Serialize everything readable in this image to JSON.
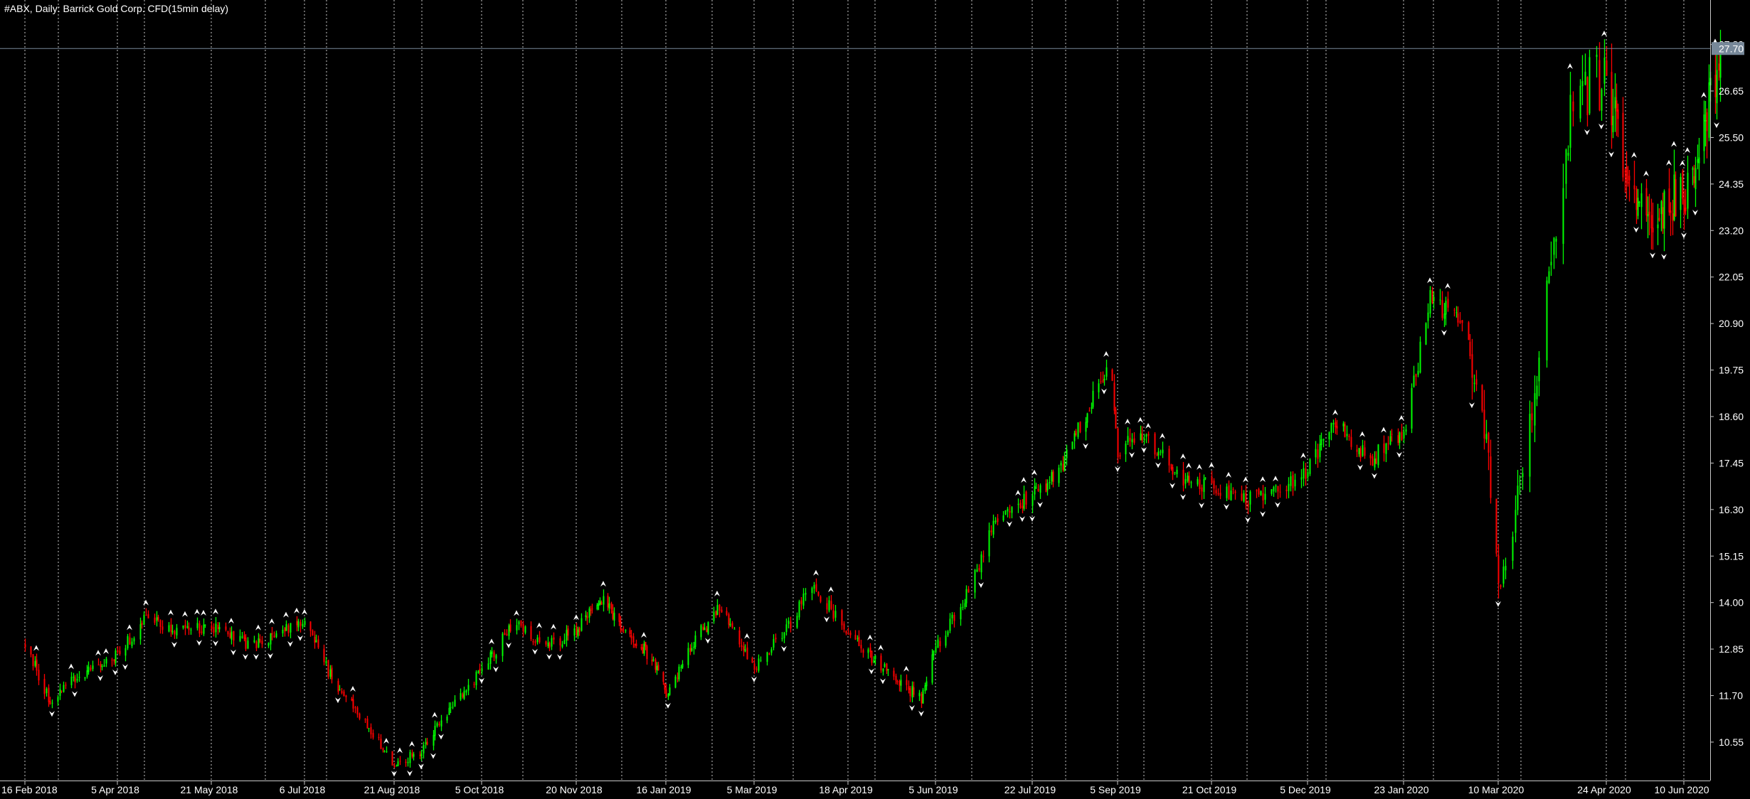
{
  "window": {
    "title": "#ABX, Daily:  Barrick Gold Corp. CFD(15min delay)"
  },
  "colors": {
    "background": "#000000",
    "bull": "#00ff00",
    "bear": "#ff0000",
    "grid": "#c8c8c8",
    "axis": "#c8c8c8",
    "text": "#ffffff",
    "price_line": "#778899",
    "price_label_bg": "#778899",
    "fractal": "#ffffff"
  },
  "chart_data": {
    "type": "candlestick",
    "title": "#ABX, Daily:  Barrick Gold Corp. CFD(15min delay)",
    "ylim": [
      9.6,
      28.9
    ],
    "y_ticks": [
      "27.80",
      "26.65",
      "25.50",
      "24.35",
      "23.20",
      "22.05",
      "20.90",
      "19.75",
      "18.60",
      "17.45",
      "16.30",
      "15.15",
      "14.00",
      "12.85",
      "11.70",
      "10.55"
    ],
    "x_ticks": [
      "16 Feb 2018",
      "5 Apr 2018",
      "21 May 2018",
      "6 Jul 2018",
      "21 Aug 2018",
      "5 Oct 2018",
      "20 Nov 2018",
      "16 Jan 2019",
      "5 Mar 2019",
      "18 Apr 2019",
      "5 Jun 2019",
      "22 Jul 2019",
      "5 Sep 2019",
      "21 Oct 2019",
      "5 Dec 2019",
      "23 Jan 2020",
      "10 Mar 2020",
      "24 Apr 2020",
      "10 Jun 2020"
    ],
    "x_tick_dates": [
      "2018-02-16",
      "2018-04-05",
      "2018-05-21",
      "2018-07-06",
      "2018-08-21",
      "2018-10-05",
      "2018-11-20",
      "2019-01-16",
      "2019-03-05",
      "2019-04-18",
      "2019-06-05",
      "2019-07-22",
      "2019-09-05",
      "2019-10-21",
      "2019-12-05",
      "2020-01-23",
      "2020-03-10",
      "2020-04-24",
      "2020-06-10"
    ],
    "grid": "vertical-dotted",
    "indicator": "fractals",
    "current_price": "27.70",
    "close_anchors": [
      [
        "2018-02-16",
        13.0
      ],
      [
        "2018-03-01",
        11.5
      ],
      [
        "2018-03-15",
        12.2
      ],
      [
        "2018-04-05",
        12.7
      ],
      [
        "2018-04-20",
        13.7
      ],
      [
        "2018-05-01",
        13.3
      ],
      [
        "2018-05-21",
        13.4
      ],
      [
        "2018-06-10",
        12.9
      ],
      [
        "2018-07-06",
        13.6
      ],
      [
        "2018-07-20",
        12.1
      ],
      [
        "2018-08-05",
        11.1
      ],
      [
        "2018-08-21",
        10.0
      ],
      [
        "2018-09-05",
        10.4
      ],
      [
        "2018-09-20",
        11.5
      ],
      [
        "2018-10-05",
        12.3
      ],
      [
        "2018-10-20",
        13.5
      ],
      [
        "2018-11-05",
        12.9
      ],
      [
        "2018-11-20",
        13.3
      ],
      [
        "2018-12-05",
        14.1
      ],
      [
        "2018-12-20",
        13.4
      ],
      [
        "2019-01-05",
        12.7
      ],
      [
        "2019-01-16",
        11.8
      ],
      [
        "2019-02-01",
        13.1
      ],
      [
        "2019-02-15",
        13.9
      ],
      [
        "2019-03-05",
        12.4
      ],
      [
        "2019-03-20",
        13.3
      ],
      [
        "2019-04-01",
        14.5
      ],
      [
        "2019-04-18",
        13.2
      ],
      [
        "2019-05-05",
        12.5
      ],
      [
        "2019-05-28",
        11.6
      ],
      [
        "2019-06-05",
        12.9
      ],
      [
        "2019-06-20",
        14.2
      ],
      [
        "2019-07-05",
        16.1
      ],
      [
        "2019-07-22",
        16.7
      ],
      [
        "2019-08-05",
        17.2
      ],
      [
        "2019-08-15",
        18.3
      ],
      [
        "2019-09-01",
        19.8
      ],
      [
        "2019-09-05",
        17.8
      ],
      [
        "2019-09-20",
        18.1
      ],
      [
        "2019-10-05",
        17.0
      ],
      [
        "2019-10-21",
        16.9
      ],
      [
        "2019-11-05",
        16.5
      ],
      [
        "2019-11-20",
        16.7
      ],
      [
        "2019-12-05",
        17.3
      ],
      [
        "2019-12-20",
        18.5
      ],
      [
        "2020-01-05",
        17.5
      ],
      [
        "2020-01-23",
        18.2
      ],
      [
        "2020-02-05",
        21.5
      ],
      [
        "2020-02-20",
        21.0
      ],
      [
        "2020-03-02",
        19.0
      ],
      [
        "2020-03-10",
        14.5
      ],
      [
        "2020-03-20",
        17.0
      ],
      [
        "2020-04-01",
        22.5
      ],
      [
        "2020-04-10",
        26.5
      ],
      [
        "2020-04-24",
        27.0
      ],
      [
        "2020-05-05",
        25.0
      ],
      [
        "2020-05-20",
        23.3
      ],
      [
        "2020-06-05",
        24.2
      ],
      [
        "2020-06-10",
        24.0
      ],
      [
        "2020-06-25",
        26.2
      ],
      [
        "2020-07-02",
        27.7
      ]
    ]
  }
}
